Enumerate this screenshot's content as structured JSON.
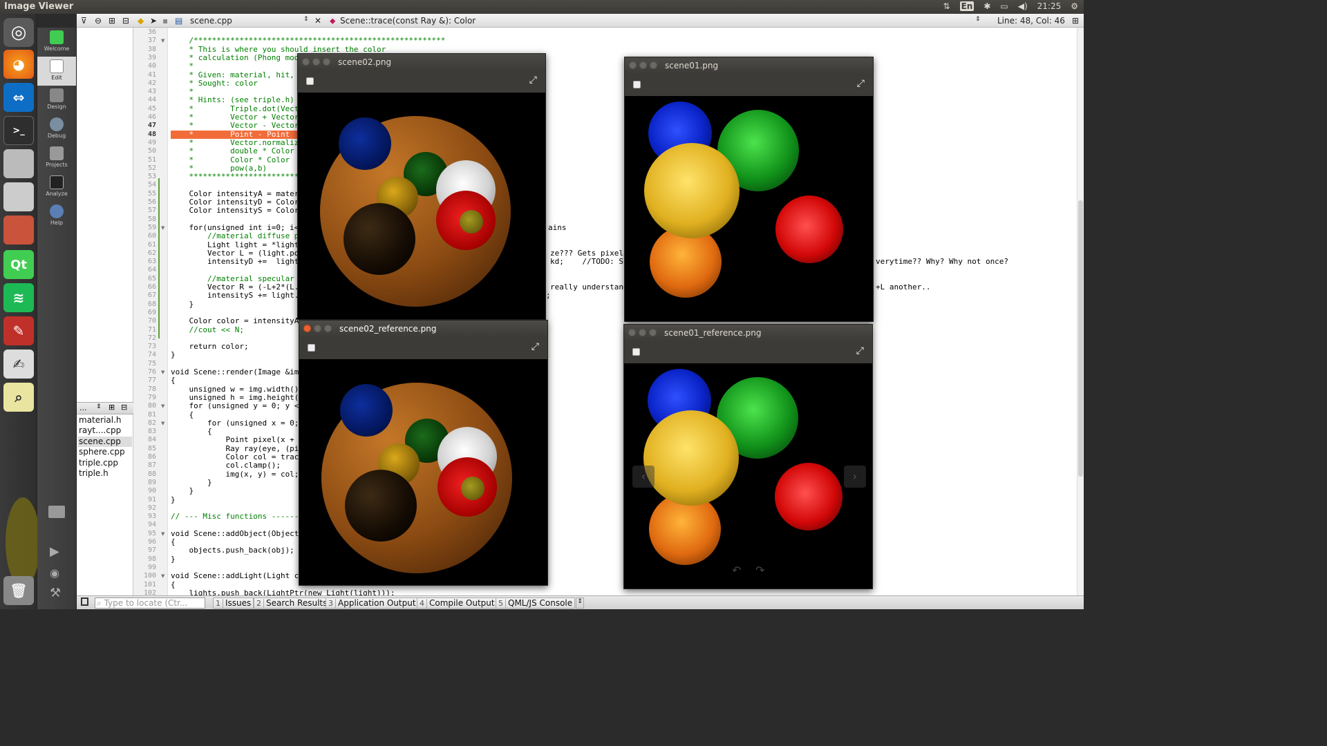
{
  "topbar": {
    "title": "Image Viewer",
    "keyboard": "En",
    "time": "21:25"
  },
  "qtbar": {
    "file": "scene.cpp",
    "function": "Scene::trace(const Ray &): Color",
    "position": "Line: 48, Col: 46"
  },
  "modes": [
    {
      "label": "Welcome"
    },
    {
      "label": "Edit"
    },
    {
      "label": "Design"
    },
    {
      "label": "Debug"
    },
    {
      "label": "Projects"
    },
    {
      "label": "Analyze"
    },
    {
      "label": "Help"
    }
  ],
  "files": {
    "header": "...",
    "items": [
      "material.h",
      "rayt....cpp",
      "scene.cpp",
      "sphere.cpp",
      "triple.cpp",
      "triple.h"
    ],
    "selected": "scene.cpp"
  },
  "code": {
    "lines": [
      {
        "n": "36",
        "t": ""
      },
      {
        "n": "37",
        "t": "    /*******************************************************"
      },
      {
        "n": "38",
        "t": "    * This is where you should insert the color"
      },
      {
        "n": "39",
        "t": "    * calculation (Phong mode"
      },
      {
        "n": "40",
        "t": "    *"
      },
      {
        "n": "41",
        "t": "    * Given: material, hit, N"
      },
      {
        "n": "42",
        "t": "    * Sought: color"
      },
      {
        "n": "43",
        "t": "    *"
      },
      {
        "n": "44",
        "t": "    * Hints: (see triple.h)"
      },
      {
        "n": "45",
        "t": "    *        Triple.dot(Vecto"
      },
      {
        "n": "46",
        "t": "    *        Vector + Vector"
      },
      {
        "n": "47",
        "t": "    *        Vector - Vector"
      },
      {
        "n": "48",
        "t": "    *        Point - Point"
      },
      {
        "n": "49",
        "t": "    *        Vector.normalize"
      },
      {
        "n": "50",
        "t": "    *        double * Color"
      },
      {
        "n": "51",
        "t": "    *        Color * Color"
      },
      {
        "n": "52",
        "t": "    *        pow(a,b)"
      },
      {
        "n": "53",
        "t": "    *************************"
      },
      {
        "n": "54",
        "t": ""
      },
      {
        "n": "55",
        "t": "    Color intensityA = materi"
      },
      {
        "n": "56",
        "t": "    Color intensityD = Color("
      },
      {
        "n": "57",
        "t": "    Color intensityS = Color("
      },
      {
        "n": "58",
        "t": ""
      },
      {
        "n": "59",
        "t": "    for(unsigned int i=0; i<l"
      },
      {
        "n": "60",
        "t": "        //material diffuse p"
      },
      {
        "n": "61",
        "t": "        Light light = *lights"
      },
      {
        "n": "62",
        "t": "        Vector L = (light.pos"
      },
      {
        "n": "63",
        "t": "        intensityD +=  light."
      },
      {
        "n": "64",
        "t": ""
      },
      {
        "n": "65",
        "t": "        //material specular p"
      },
      {
        "n": "66",
        "t": "        Vector R = (-L+2*(L.d"
      },
      {
        "n": "67",
        "t": "        intensityS += light.c"
      },
      {
        "n": "68",
        "t": "    }"
      },
      {
        "n": "69",
        "t": ""
      },
      {
        "n": "70",
        "t": "    Color color = intensityA "
      },
      {
        "n": "71",
        "t": "    //cout << N;"
      },
      {
        "n": "72",
        "t": ""
      },
      {
        "n": "73",
        "t": "    return color;"
      },
      {
        "n": "74",
        "t": "}"
      },
      {
        "n": "75",
        "t": ""
      },
      {
        "n": "76",
        "t": "void Scene::render(Image &img"
      },
      {
        "n": "77",
        "t": "{"
      },
      {
        "n": "78",
        "t": "    unsigned w = img.width();"
      },
      {
        "n": "79",
        "t": "    unsigned h = img.height()"
      },
      {
        "n": "80",
        "t": "    for (unsigned y = 0; y <"
      },
      {
        "n": "81",
        "t": "    {"
      },
      {
        "n": "82",
        "t": "        for (unsigned x = 0;"
      },
      {
        "n": "83",
        "t": "        {"
      },
      {
        "n": "84",
        "t": "            Point pixel(x + 0"
      },
      {
        "n": "85",
        "t": "            Ray ray(eye, (pix"
      },
      {
        "n": "86",
        "t": "            Color col = trace"
      },
      {
        "n": "87",
        "t": "            col.clamp();"
      },
      {
        "n": "88",
        "t": "            img(x, y) = col;"
      },
      {
        "n": "89",
        "t": "        }"
      },
      {
        "n": "90",
        "t": "    }"
      },
      {
        "n": "91",
        "t": "}"
      },
      {
        "n": "92",
        "t": ""
      },
      {
        "n": "93",
        "t": "// --- Misc functions -------"
      },
      {
        "n": "94",
        "t": ""
      },
      {
        "n": "95",
        "t": "void Scene::addObject(ObjectP"
      },
      {
        "n": "96",
        "t": "{"
      },
      {
        "n": "97",
        "t": "    objects.push_back(obj);"
      },
      {
        "n": "98",
        "t": "}"
      },
      {
        "n": "99",
        "t": ""
      },
      {
        "n": "100",
        "t": "void Scene::addLight(Light co"
      },
      {
        "n": "101",
        "t": "{"
      },
      {
        "n": "102",
        "t": "    lights.push_back(LightPtr(new Light(light)));"
      }
    ],
    "fragments": {
      "f59": "ains",
      "f62": "ze??? Gets pixelat",
      "f63a": "kd;    //TODO: Sli",
      "f63b": "verytime?? Why? Why not once?",
      "f66a": "really understand",
      "f66b": "+L another..",
      "f67": ";"
    }
  },
  "windows": {
    "w1": {
      "title": "scene02.png"
    },
    "w2": {
      "title": "scene01.png"
    },
    "w3": {
      "title": "scene02_reference.png"
    },
    "w4": {
      "title": "scene01_reference.png"
    }
  },
  "bottom": {
    "locate_placeholder": "Type to locate (Ctr...",
    "tabs": [
      {
        "n": "1",
        "l": "Issues"
      },
      {
        "n": "2",
        "l": "Search Results"
      },
      {
        "n": "3",
        "l": "Application Output"
      },
      {
        "n": "4",
        "l": "Compile Output"
      },
      {
        "n": "5",
        "l": "QML/JS Console"
      }
    ]
  },
  "colors": {
    "accent": "#e9602f",
    "highlight_line": "#f26c3a",
    "comment": "#008000"
  }
}
